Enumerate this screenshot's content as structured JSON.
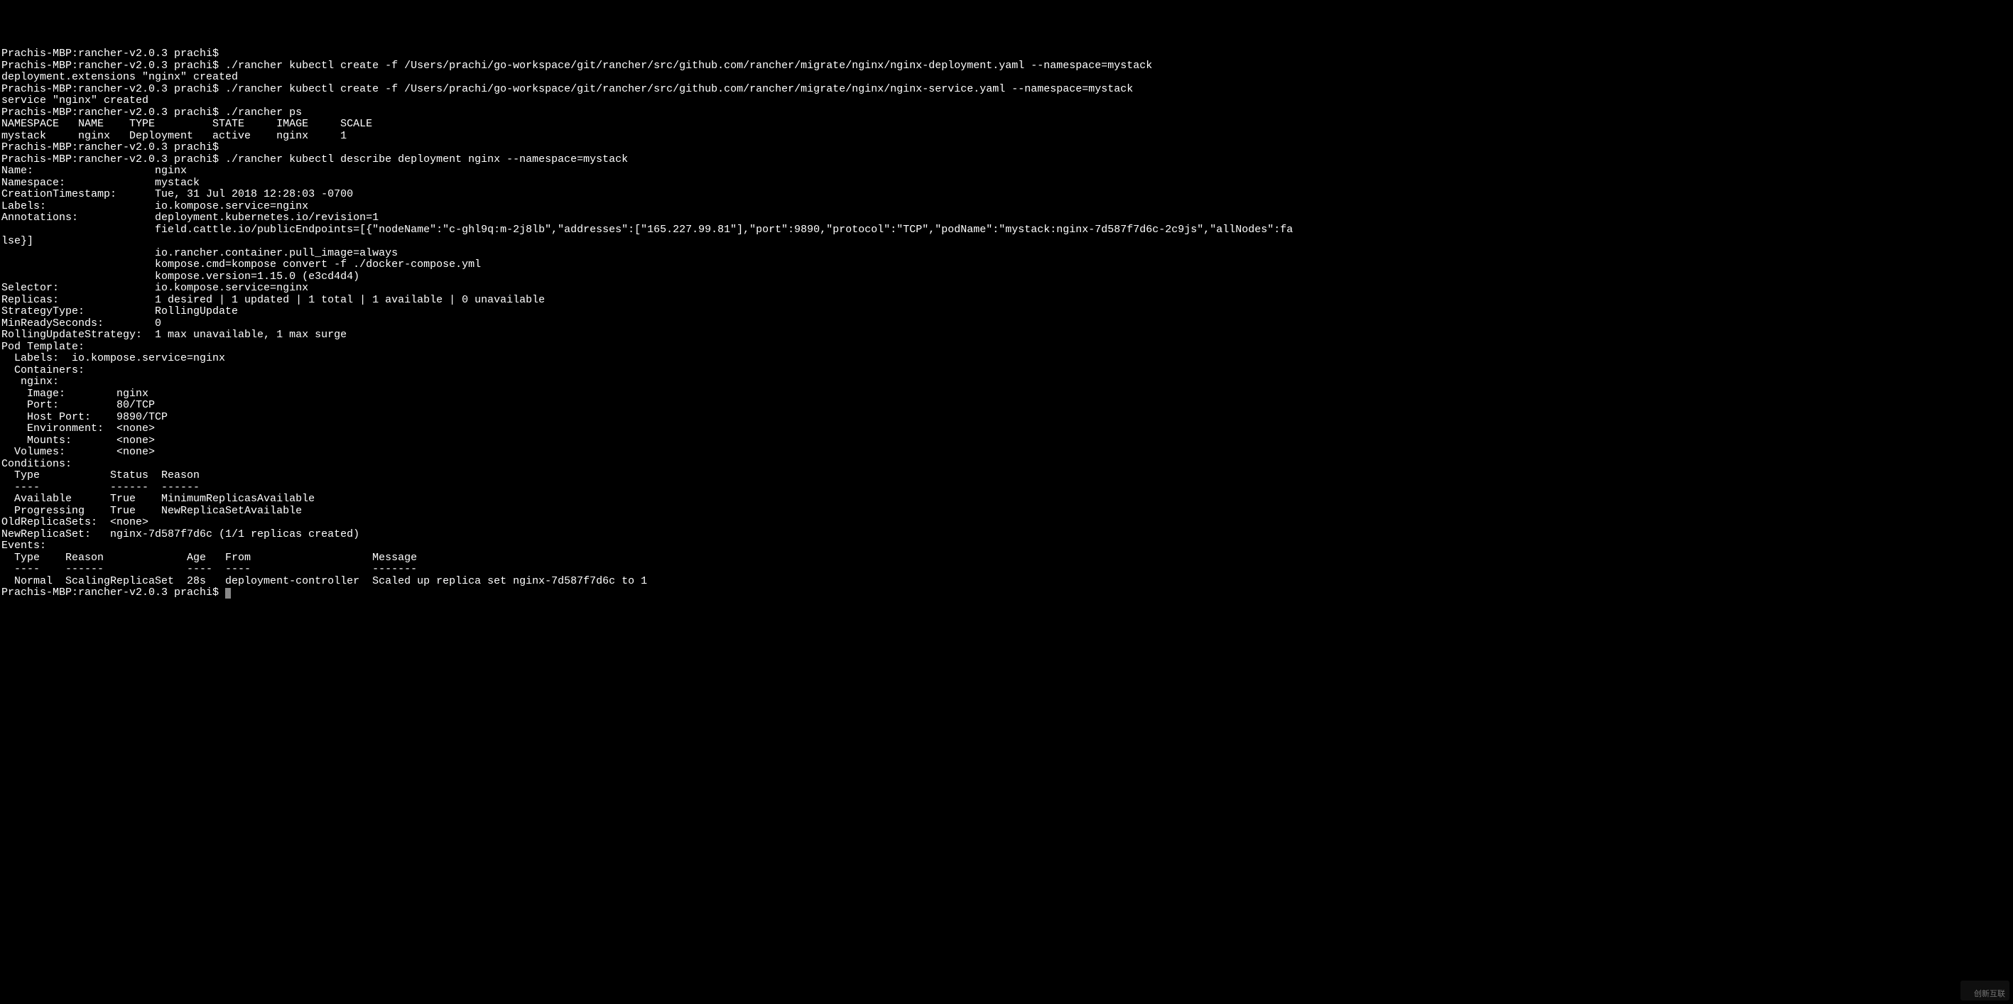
{
  "prompt_host": "Prachis-MBP:rancher-v2.0.3 prachi$",
  "lines": [
    "Prachis-MBP:rancher-v2.0.3 prachi$",
    "Prachis-MBP:rancher-v2.0.3 prachi$ ./rancher kubectl create -f /Users/prachi/go-workspace/git/rancher/src/github.com/rancher/migrate/nginx/nginx-deployment.yaml --namespace=mystack",
    "deployment.extensions \"nginx\" created",
    "Prachis-MBP:rancher-v2.0.3 prachi$ ./rancher kubectl create -f /Users/prachi/go-workspace/git/rancher/src/github.com/rancher/migrate/nginx/nginx-service.yaml --namespace=mystack",
    "service \"nginx\" created",
    "Prachis-MBP:rancher-v2.0.3 prachi$ ./rancher ps",
    "NAMESPACE   NAME    TYPE         STATE     IMAGE     SCALE",
    "mystack     nginx   Deployment   active    nginx     1",
    "Prachis-MBP:rancher-v2.0.3 prachi$",
    "Prachis-MBP:rancher-v2.0.3 prachi$ ./rancher kubectl describe deployment nginx --namespace=mystack",
    "Name:                   nginx",
    "Namespace:              mystack",
    "CreationTimestamp:      Tue, 31 Jul 2018 12:28:03 -0700",
    "Labels:                 io.kompose.service=nginx",
    "Annotations:            deployment.kubernetes.io/revision=1",
    "                        field.cattle.io/publicEndpoints=[{\"nodeName\":\"c-ghl9q:m-2j8lb\",\"addresses\":[\"165.227.99.81\"],\"port\":9890,\"protocol\":\"TCP\",\"podName\":\"mystack:nginx-7d587f7d6c-2c9js\",\"allNodes\":fa",
    "lse}]",
    "                        io.rancher.container.pull_image=always",
    "                        kompose.cmd=kompose convert -f ./docker-compose.yml",
    "                        kompose.version=1.15.0 (e3cd4d4)",
    "Selector:               io.kompose.service=nginx",
    "Replicas:               1 desired | 1 updated | 1 total | 1 available | 0 unavailable",
    "StrategyType:           RollingUpdate",
    "MinReadySeconds:        0",
    "RollingUpdateStrategy:  1 max unavailable, 1 max surge",
    "Pod Template:",
    "  Labels:  io.kompose.service=nginx",
    "  Containers:",
    "   nginx:",
    "    Image:        nginx",
    "    Port:         80/TCP",
    "    Host Port:    9890/TCP",
    "    Environment:  <none>",
    "    Mounts:       <none>",
    "  Volumes:        <none>",
    "Conditions:",
    "  Type           Status  Reason",
    "  ----           ------  ------",
    "  Available      True    MinimumReplicasAvailable",
    "  Progressing    True    NewReplicaSetAvailable",
    "OldReplicaSets:  <none>",
    "NewReplicaSet:   nginx-7d587f7d6c (1/1 replicas created)",
    "Events:",
    "  Type    Reason             Age   From                   Message",
    "  ----    ------             ----  ----                   -------",
    "  Normal  ScalingReplicaSet  28s   deployment-controller  Scaled up replica set nginx-7d587f7d6c to 1"
  ],
  "final_prompt": "Prachis-MBP:rancher-v2.0.3 prachi$ ",
  "watermark": "创新互联"
}
